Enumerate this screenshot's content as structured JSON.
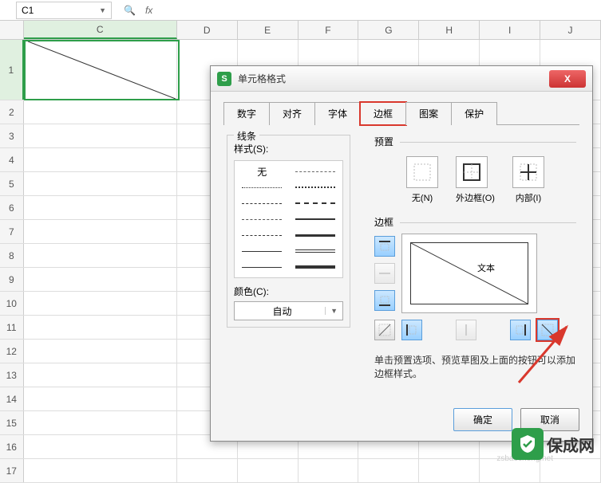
{
  "formula_bar": {
    "cell_ref": "C1",
    "fx": "fx"
  },
  "columns": [
    "C",
    "D",
    "E",
    "F",
    "G",
    "H",
    "I",
    "J"
  ],
  "rows": [
    "1",
    "2",
    "3",
    "4",
    "5",
    "6",
    "7",
    "8",
    "9",
    "10",
    "11",
    "12",
    "13",
    "14",
    "15",
    "16",
    "17"
  ],
  "dialog": {
    "title": "单元格格式",
    "close": "X",
    "tabs": {
      "number": "数字",
      "align": "对齐",
      "font": "字体",
      "border": "边框",
      "pattern": "图案",
      "protect": "保护"
    },
    "line_section": "线条",
    "style_label": "样式(S):",
    "style_none": "无",
    "color_label": "颜色(C):",
    "color_value": "自动",
    "preset_section": "预置",
    "presets": {
      "none": "无(N)",
      "outer": "外边框(O)",
      "inner": "内部(I)"
    },
    "border_section": "边框",
    "preview_text": "文本",
    "hint": "单击预置选项、预览草图及上面的按钮可以添加边框样式。",
    "ok": "确定",
    "cancel": "取消"
  },
  "watermark": "zsbaocheng.net",
  "logo": "保成网"
}
